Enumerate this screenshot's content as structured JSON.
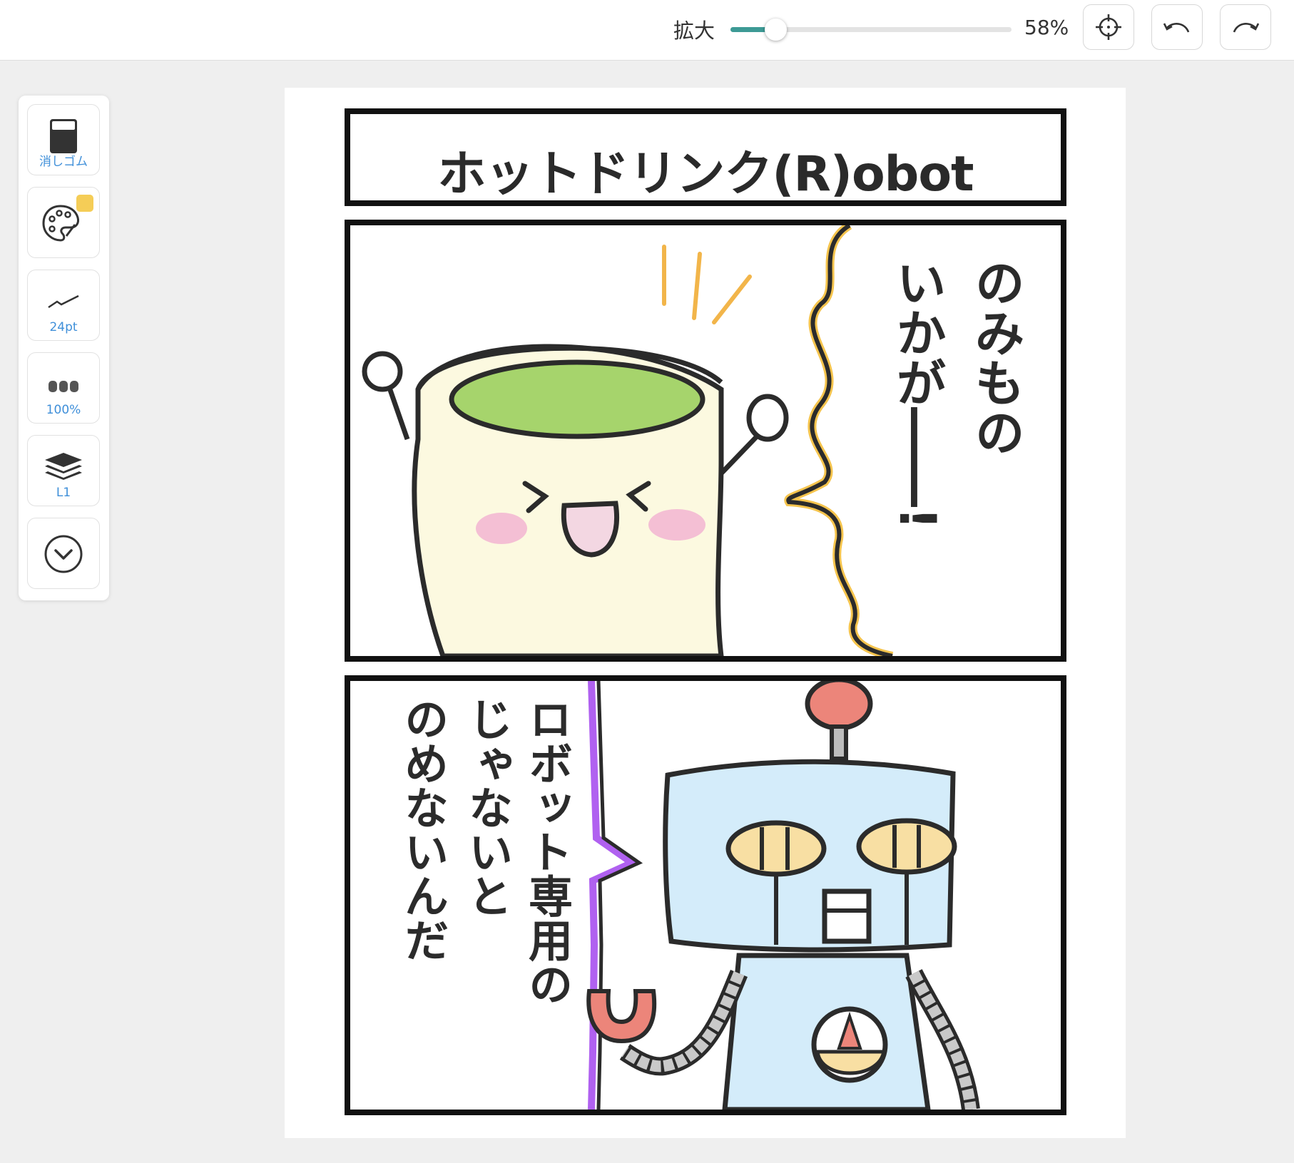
{
  "toolbar": {
    "zoom_label": "拡大",
    "zoom_value": "58%",
    "zoom_fraction": 0.16,
    "buttons": [
      {
        "icon": "crosshair-icon"
      },
      {
        "icon": "undo-icon"
      },
      {
        "icon": "redo-icon"
      }
    ]
  },
  "tools": {
    "eraser_label": "消しゴム",
    "color_icon": "palette-icon",
    "current_color": "#f5cd57",
    "brush_size_label": "24pt",
    "opacity_label": "100%",
    "layer_label": "L1",
    "more_icon": "chevron-down-circle-icon"
  },
  "comic": {
    "title": "ホットドリンク(R)obot",
    "panel1_bubble": [
      "のみもの",
      "いかが――!"
    ],
    "panel2_bubble": [
      "ロボット専用の",
      "じゃないと",
      "のめないんだ"
    ]
  },
  "colors": {
    "accent": "#3d9a95",
    "label_blue": "#3f8fd9",
    "cup_body": "#fcf9e0",
    "tea": "#a6d46c",
    "robot_body": "#d4ecfa",
    "antenna": "#ec857a",
    "eyes": "#f8dfa3",
    "spark": "#f2b54a",
    "bubble_edge_1": "#f5c44d",
    "bubble_edge_2": "#b061f0"
  }
}
